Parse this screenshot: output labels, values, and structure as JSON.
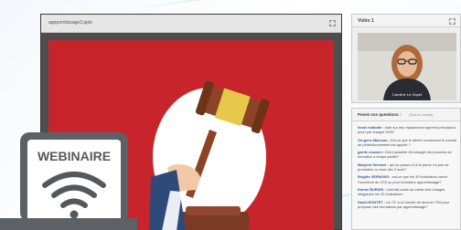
{
  "presentation": {
    "window_title": "appprentissage2.pptx"
  },
  "video": {
    "header": "Vidéo 1",
    "speaker_name": "Caroline Le Goyet"
  },
  "questions": {
    "header_title": "Posez vos questions :",
    "header_subtitle": "(Tout le monde)",
    "items": [
      {
        "author": "Israel matiotte :",
        "text": "note sur leur équipement apprend principal à priori par chaque SHG!"
      },
      {
        "author": "Gergene Marceau :",
        "text": "Est-ce que le dérivé concernant le conseil de perfectionnement est appelé ?"
      },
      {
        "author": "gaelle masson :",
        "text": "Est-il possible d'envisager des process de formation à temps partiel?"
      },
      {
        "author": "Marjorie Hemmel :",
        "text": "qui se passe-t-il si le jeune n'a pas de promotion ou bout des 3 mois?"
      },
      {
        "author": "Brigitte VERNONG :",
        "text": "est-ce que les 32 indicateurs avent l'ouverture du CFA ou pour formateur apprentissage?"
      },
      {
        "author": "Karine BURDIN :",
        "text": "cela fait partie du cahier des charges obligatoire les 32 indicateurs"
      },
      {
        "author": "David BONTET :",
        "text": "Un CF a-t-il besoin de devenir CFA pour proposer des formations par apprentissage?"
      }
    ]
  },
  "badge": {
    "label": "WEBINAIRE"
  },
  "colors": {
    "slide_red": "#c8242c",
    "laptop_gray": "#5d6166",
    "author_blue": "#2f5e9e"
  }
}
